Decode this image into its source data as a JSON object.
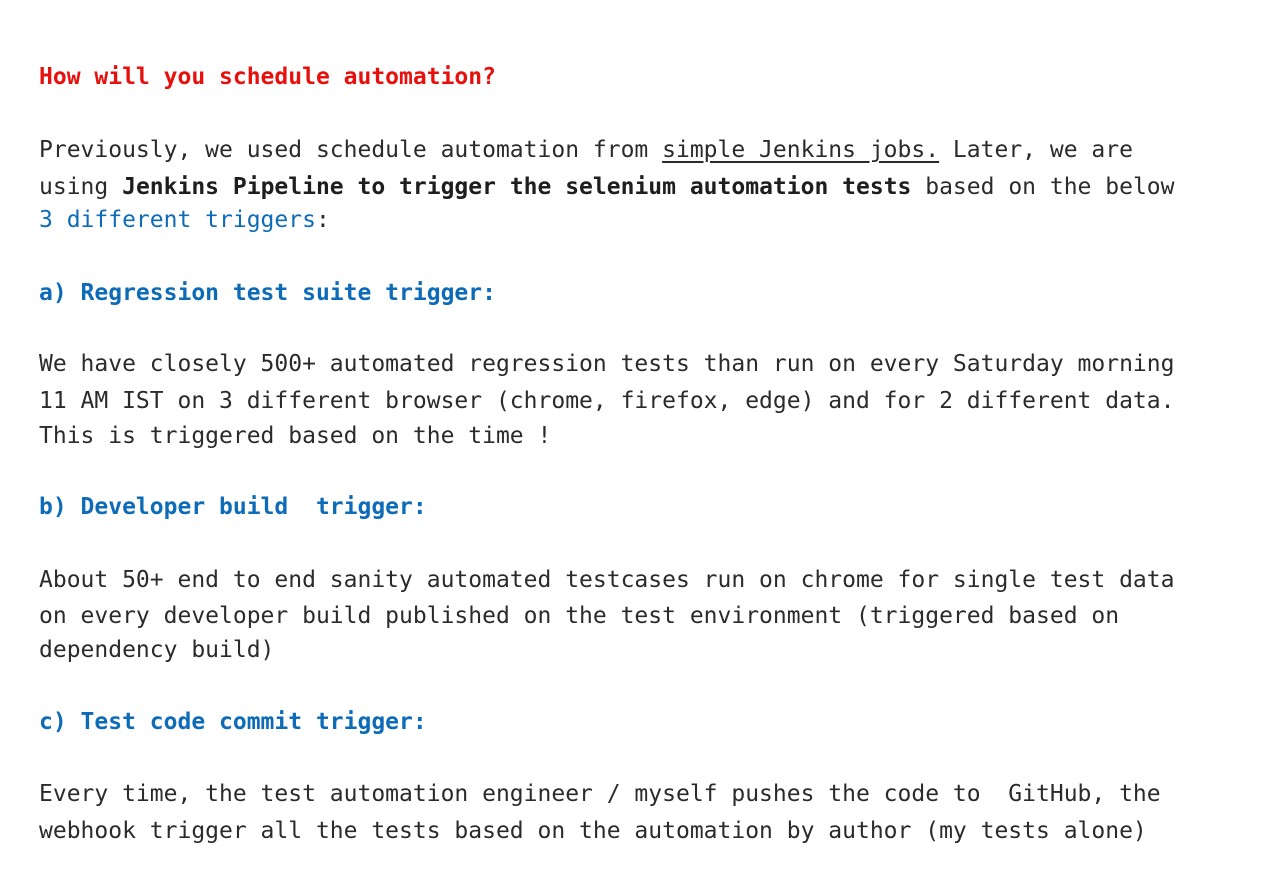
{
  "heading": "How will you schedule automation?",
  "intro": {
    "line1_before_link": "Previously, we used schedule automation from ",
    "link_text": "simple Jenkins jobs.",
    "line1_after_link": " Later, we are",
    "line2_before_bold": "using ",
    "line2_bold": "Jenkins Pipeline to trigger the selenium automation tests",
    "line2_after_bold": " based on the below",
    "line3_blue": "3 different triggers",
    "line3_after": ":"
  },
  "sections": [
    {
      "title": "a) Regression test suite trigger:",
      "lines": [
        "We have closely 500+ automated regression tests than run on every Saturday morning",
        "11 AM IST on 3 different browser (chrome, firefox, edge) and for 2 different data.",
        "This is triggered based on the time !"
      ]
    },
    {
      "title": "b) Developer build  trigger:",
      "lines": [
        "About 50+ end to end sanity automated testcases run on chrome for single test data",
        "on every developer build published on the test environment (triggered based on",
        "dependency build)"
      ]
    },
    {
      "title": "c) Test code commit trigger:",
      "lines": [
        "Every time, the test automation engineer / myself pushes the code to  GitHub, the",
        "webhook trigger all the tests based on the automation by author (my tests alone)"
      ]
    }
  ],
  "colors": {
    "heading_red": "#e8100d",
    "section_blue": "#0e6bb8",
    "body_text": "#2b2b2b"
  }
}
